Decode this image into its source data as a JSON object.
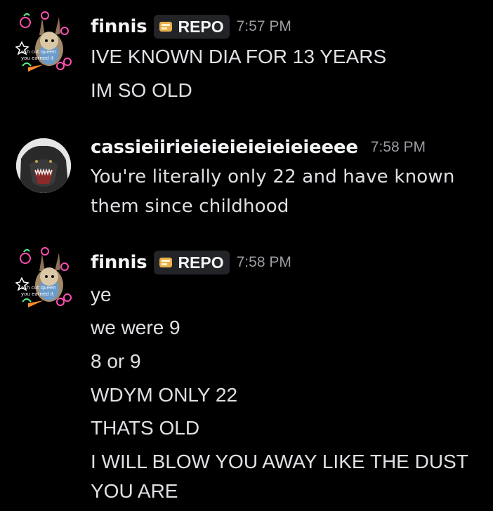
{
  "messages": [
    {
      "author": "finnis",
      "tag": "REPO",
      "time": "7:57 PM",
      "avatar_caption": [
        "ash cut queen",
        "you earned it"
      ],
      "lines": [
        "IVE KNOWN DIA FOR 13 YEARS",
        "IM SO OLD"
      ]
    },
    {
      "author": "cassieiirieieieieieieieieeee",
      "time": "7:58 PM",
      "lines": [
        "You're literally only 22 and have known",
        "them since childhood"
      ]
    },
    {
      "author": "finnis",
      "tag": "REPO",
      "time": "7:58 PM",
      "avatar_caption": [
        "ash cut queen",
        "you earned it"
      ],
      "lines": [
        "ye",
        "we were 9",
        "8 or 9",
        "WDYM ONLY 22",
        "THATS OLD",
        "I WILL BLOW YOU AWAY LIKE THE DUST",
        "YOU ARE"
      ]
    }
  ],
  "icons": {
    "avatar_1": "decorated-bunny-avatar",
    "avatar_2": "godzilla-avatar",
    "tag": "repo-tag-icon"
  },
  "colors": {
    "background": "#000000",
    "username": "#f2f3f5",
    "text": "#dfe0e4",
    "timestamp": "#9b9ca3",
    "tag_bg": "#232428",
    "neon_pink": "#ff4fb3",
    "neon_green": "#56f08a",
    "neon_orange": "#ff8a2a"
  }
}
